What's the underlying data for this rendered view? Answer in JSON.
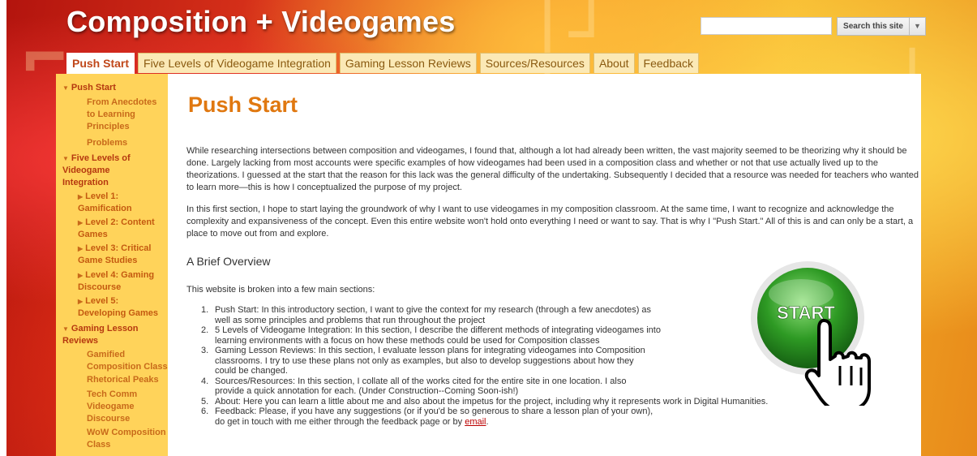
{
  "header": {
    "site_title": "Composition + Videogames",
    "search_button": "Search this site",
    "search_value": "",
    "dropdown_icon": "chevron-down-icon"
  },
  "tabs": [
    {
      "label": "Push Start",
      "active": true
    },
    {
      "label": "Five Levels of Videogame Integration",
      "active": false
    },
    {
      "label": "Gaming Lesson Reviews",
      "active": false
    },
    {
      "label": "Sources/Resources",
      "active": false
    },
    {
      "label": "About",
      "active": false
    },
    {
      "label": "Feedback",
      "active": false
    }
  ],
  "sidebar": {
    "items": [
      {
        "label": "Push Start",
        "level": 0,
        "expanded": true
      },
      {
        "label": "From Anecdotes to Learning Principles",
        "level": 1
      },
      {
        "label": "Problems",
        "level": 1
      },
      {
        "label": "Five Levels of Videogame Integration",
        "level": 0,
        "expanded": true
      },
      {
        "label": "Level 1: Gamification",
        "level": 1,
        "collapsed": true
      },
      {
        "label": "Level 2: Content Games",
        "level": 1,
        "collapsed": true
      },
      {
        "label": "Level 3: Critical Game Studies",
        "level": 1,
        "collapsed": true
      },
      {
        "label": "Level 4: Gaming Discourse",
        "level": 1,
        "collapsed": true
      },
      {
        "label": "Level 5: Developing Games",
        "level": 1,
        "collapsed": true
      },
      {
        "label": "Gaming Lesson Reviews",
        "level": 0,
        "expanded": true
      },
      {
        "label": "Gamified Composition Class",
        "level": 1
      },
      {
        "label": "Rhetorical Peaks",
        "level": 1
      },
      {
        "label": "Tech Comm Videogame Discourse",
        "level": 1
      },
      {
        "label": "WoW Composition Class",
        "level": 1
      }
    ]
  },
  "main": {
    "title": "Push Start",
    "para1": "While researching intersections between composition and videogames, I found that, although a lot had already been written, the vast majority seemed to be theorizing why it should be done. Largely lacking from most accounts were specific examples of how videogames had been used in a composition class and whether or not that use actually lived up to the theorizations. I guessed at the start that the reason for this lack was the general difficulty of the undertaking. Subsequently I decided that a resource was needed for teachers who wanted to learn more—this is how I conceptualized the purpose of my project.",
    "para2": "In this first section, I hope to start laying the groundwork of why I want to use videogames in my composition classroom. At the same time, I want to recognize and acknowledge the complexity and expansiveness of the concept. Even this entire website won't hold onto everything I need or want to say. That is why I \"Push Start.\" All of this is and can only be a start, a place to move out from and explore.",
    "subheading": "A Brief Overview",
    "intro": "This website is broken into a few main sections:",
    "list": [
      {
        "num": "1.",
        "lines": [
          "Push Start: In this introductory section, I want to give the context for my research (through a few anecdotes) as",
          "well as some principles and problems that run throughout the project"
        ]
      },
      {
        "num": "2.",
        "lines": [
          "5 Levels of Videogame Integration: In this section, I describe the different methods of integrating videogames into",
          "learning environments with a focus on how these methods could be used for Composition classes"
        ]
      },
      {
        "num": "3.",
        "lines": [
          "Gaming Lesson Reviews: In this section, I evaluate lesson plans for integrating videogames into Composition",
          "classrooms. I try to use these plans not only as examples, but also to develop suggestions about how they",
          "could be changed."
        ]
      },
      {
        "num": "4.",
        "lines": [
          "Sources/Resources: In this section, I collate all of the works cited for the entire site in one location. I also",
          "provide a quick annotation for each. (Under Construction--Coming Soon-ish!)"
        ]
      },
      {
        "num": "5.",
        "lines": [
          "About: Here you can learn a little about me and also about the impetus for the project, including why it represents work in Digital Humanities."
        ]
      },
      {
        "num": "6.",
        "lines": [
          "Feedback: Please, if you have any suggestions (or if you'd be so generous to share a lesson plan of your own),",
          "do get in touch with me either through the feedback page or by "
        ]
      }
    ],
    "email_link": "email",
    "email_after": ".",
    "start_button_text": "START"
  },
  "colors": {
    "accent": "#e07810",
    "sidebar_bg": "#ffd35a",
    "link": "#b00000"
  }
}
